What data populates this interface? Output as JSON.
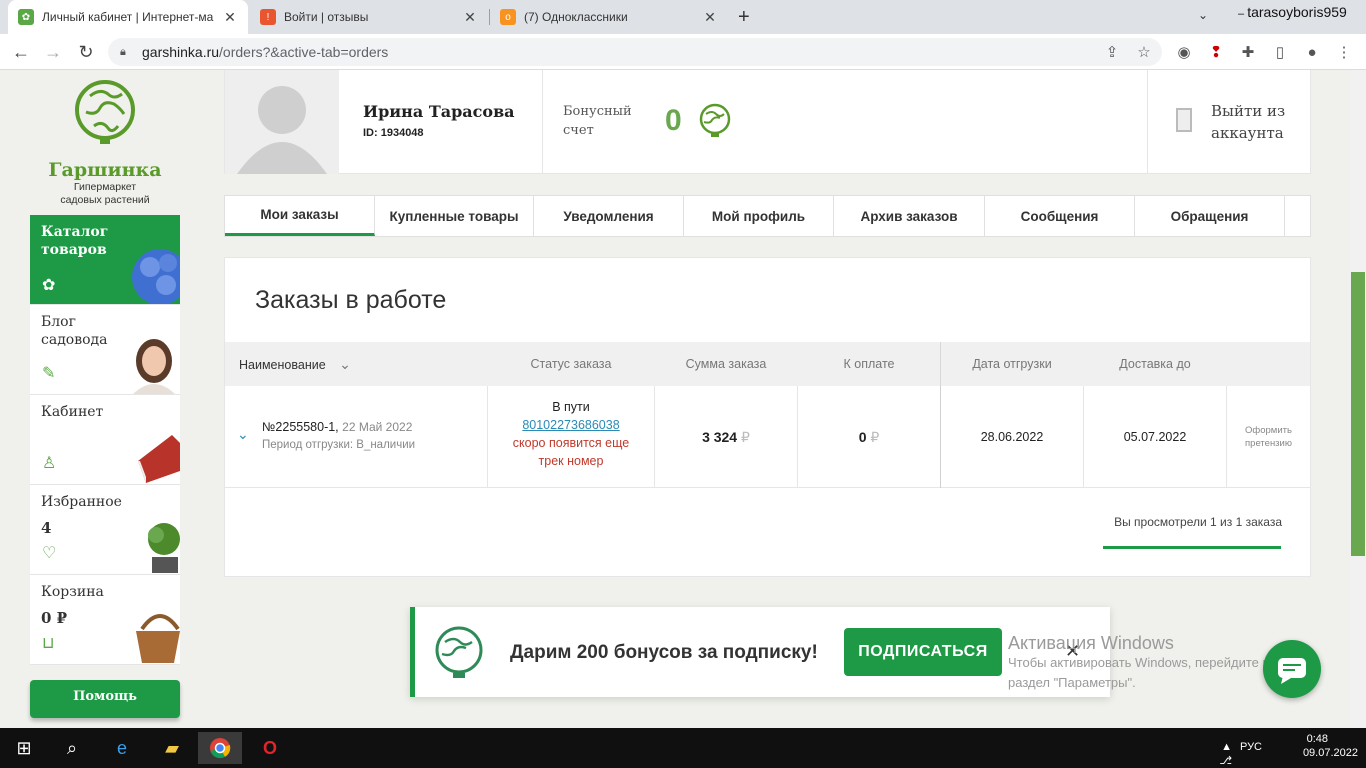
{
  "browser": {
    "tabs": [
      {
        "title": "Личный кабинет | Интернет-ма"
      },
      {
        "title": "Войти | отзывы"
      },
      {
        "title": "(7) Одноклассники"
      }
    ],
    "url_host": "garshinka.ru",
    "url_path": "/orders?&active-tab=orders",
    "profile_user": "tarasoyboris959"
  },
  "sidebar": {
    "brand": "Гаршинка",
    "tagline_1": "Гипермаркет",
    "tagline_2": "садовых растений",
    "items": [
      {
        "label": "Каталог товаров"
      },
      {
        "label": "Блог садовода"
      },
      {
        "label": "Кабинет"
      },
      {
        "label": "Избранное",
        "value": "4"
      },
      {
        "label": "Корзина",
        "value": "0 ₽"
      }
    ],
    "help": "Помощь"
  },
  "profile": {
    "name": "Ирина Тарасова",
    "id": "ID: 1934048",
    "bonus_label_1": "Бонусный",
    "bonus_label_2": "счет",
    "bonus_value": "0",
    "logout_1": "Выйти из",
    "logout_2": "аккаунта"
  },
  "tabs": [
    {
      "label": "Мои заказы"
    },
    {
      "label": "Купленные товары"
    },
    {
      "label": "Уведомления"
    },
    {
      "label": "Мой профиль"
    },
    {
      "label": "Архив заказов"
    },
    {
      "label": "Сообщения"
    },
    {
      "label": "Обращения"
    }
  ],
  "orders": {
    "title": "Заказы в работе",
    "columns": [
      "Наименование",
      "Статус заказа",
      "Сумма заказа",
      "К оплате",
      "Дата отгрузки",
      "Доставка до"
    ],
    "row": {
      "number": "№2255580-1,",
      "date": "22 Май 2022",
      "period": "Период отгрузки: В_наличии",
      "status": "В пути",
      "track": "80102273686038",
      "track_note_1": "скоро появится еще",
      "track_note_2": "трек номер",
      "sum": "3 324",
      "to_pay": "0",
      "currency": "₽",
      "ship_date": "28.06.2022",
      "delivery_date": "05.07.2022",
      "claim_1": "Оформить",
      "claim_2": "претензию"
    },
    "footnote": "Вы просмотрели 1 из 1 заказа"
  },
  "subscribe": {
    "text": "Дарим 200 бонусов за подписку!",
    "button": "ПОДПИСАТЬСЯ"
  },
  "windows_activation": {
    "line1": "Активация Windows",
    "line2": "Чтобы активировать Windows, перейдите в",
    "line3": "раздел \"Параметры\"."
  },
  "taskbar": {
    "lang": "РУС",
    "time": "0:48",
    "date": "09.07.2022"
  },
  "colors": {
    "brand_green": "#1e9a46",
    "accent_green": "#6aa84f"
  }
}
